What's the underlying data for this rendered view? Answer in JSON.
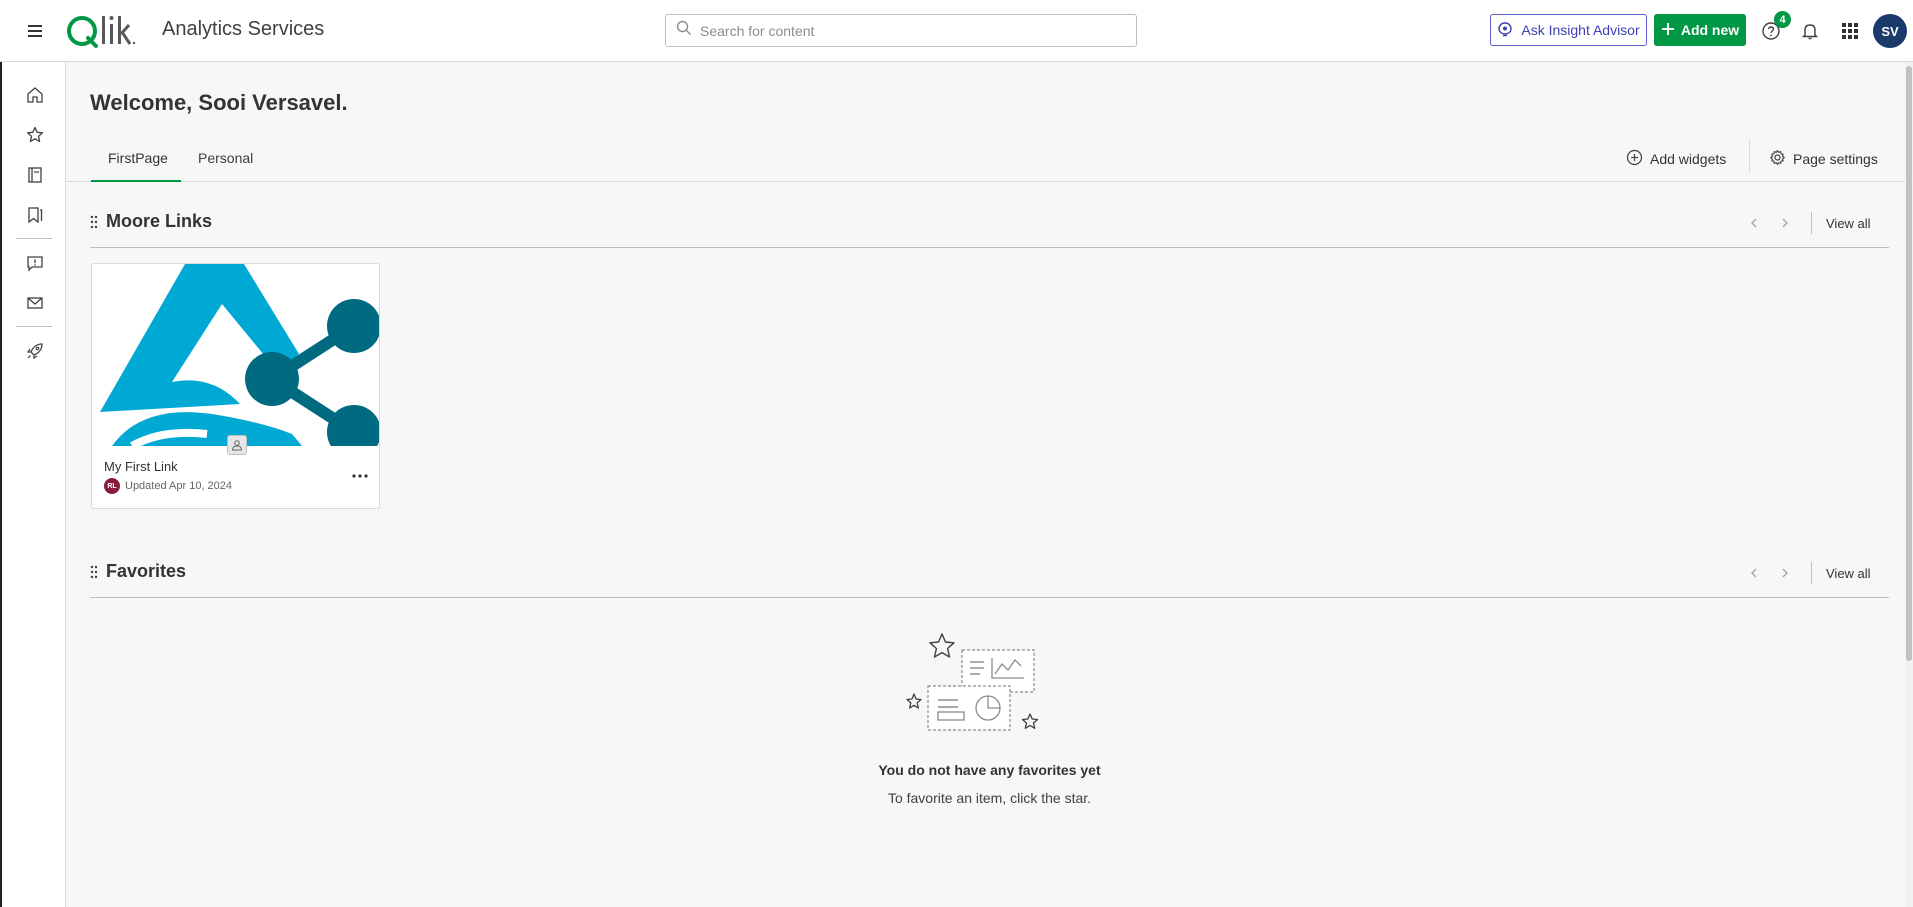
{
  "topbar": {
    "app_title": "Analytics Services",
    "search_placeholder": "Search for content",
    "insight_label": "Ask Insight Advisor",
    "add_new_label": "Add new",
    "notification_badge": "4",
    "user_initials": "SV",
    "accent": "#009845",
    "insight_color": "#3f3fb8",
    "avatar_color": "#1a3a6c"
  },
  "rail": {
    "icons": [
      "home-icon",
      "star-icon",
      "catalog-icon",
      "collections-icon",
      "feedback-icon",
      "mail-icon",
      "rocket-icon"
    ]
  },
  "header": {
    "welcome": "Welcome, Sooi Versavel.",
    "tabs": [
      {
        "label": "FirstPage",
        "active": true
      },
      {
        "label": "Personal",
        "active": false
      }
    ],
    "add_widgets_label": "Add widgets",
    "page_settings_label": "Page settings"
  },
  "sections": [
    {
      "title": "Moore Links",
      "view_all": "View all",
      "cards": [
        {
          "title": "My First Link",
          "owner_initials": "RL",
          "updated": "Updated Apr 10, 2024"
        }
      ]
    },
    {
      "title": "Favorites",
      "view_all": "View all",
      "empty_title": "You do not have any favorites yet",
      "empty_subtitle": "To favorite an item, click the star."
    }
  ]
}
